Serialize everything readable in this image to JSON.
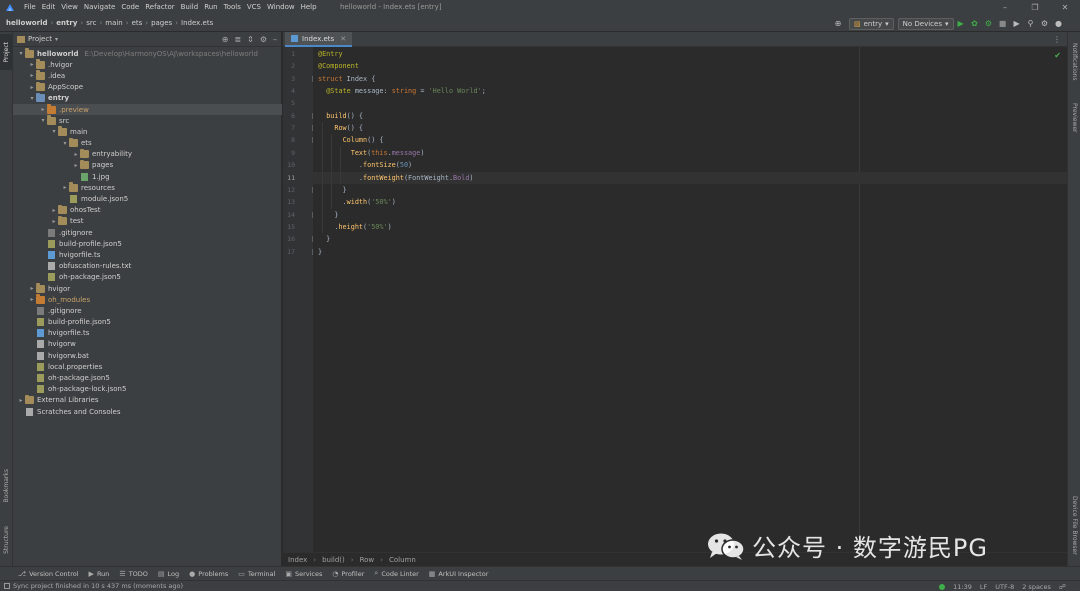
{
  "titlebar": {
    "menu": [
      "File",
      "Edit",
      "View",
      "Navigate",
      "Code",
      "Refactor",
      "Build",
      "Run",
      "Tools",
      "VCS",
      "Window",
      "Help"
    ],
    "window_title": "helloworld - Index.ets [entry]"
  },
  "breadcrumb": [
    "helloworld",
    "entry",
    "src",
    "main",
    "ets",
    "pages",
    "Index.ets"
  ],
  "toolbar": {
    "module": "entry",
    "device": "No Devices"
  },
  "left_strip": {
    "project": "Project",
    "bookmarks": "Bookmarks",
    "structure": "Structure"
  },
  "right_strip": {
    "notifications": "Notifications",
    "previewer": "Previewer",
    "device_file_browser": "Device File Browser"
  },
  "project_panel": {
    "title": "Project",
    "tree": [
      {
        "label": "helloworld",
        "path": "E:\\Develop\\HarmonyOS\\AJ\\workspaces\\helloworld",
        "level": 0,
        "type": "folder",
        "expanded": true,
        "bold": true
      },
      {
        "label": ".hvigor",
        "level": 1,
        "type": "folder",
        "expanded": false
      },
      {
        "label": ".idea",
        "level": 1,
        "type": "folder",
        "expanded": false
      },
      {
        "label": "AppScope",
        "level": 1,
        "type": "folder",
        "expanded": false
      },
      {
        "label": "entry",
        "level": 1,
        "type": "folder-blue",
        "expanded": true,
        "bold": true
      },
      {
        "label": ".preview",
        "level": 2,
        "type": "folder-orange",
        "expanded": false,
        "selected": true,
        "orange": true
      },
      {
        "label": "src",
        "level": 2,
        "type": "folder",
        "expanded": true
      },
      {
        "label": "main",
        "level": 3,
        "type": "folder",
        "expanded": true
      },
      {
        "label": "ets",
        "level": 4,
        "type": "folder",
        "expanded": true
      },
      {
        "label": "entryability",
        "level": 5,
        "type": "folder",
        "expanded": false
      },
      {
        "label": "pages",
        "level": 5,
        "type": "folder",
        "expanded": false
      },
      {
        "label": "1.jpg",
        "level": 5,
        "type": "img"
      },
      {
        "label": "resources",
        "level": 4,
        "type": "folder",
        "expanded": false
      },
      {
        "label": "module.json5",
        "level": 4,
        "type": "json"
      },
      {
        "label": "ohosTest",
        "level": 3,
        "type": "folder",
        "expanded": false
      },
      {
        "label": "test",
        "level": 3,
        "type": "folder",
        "expanded": false
      },
      {
        "label": ".gitignore",
        "level": 2,
        "type": "git"
      },
      {
        "label": "build-profile.json5",
        "level": 2,
        "type": "json"
      },
      {
        "label": "hvigorfile.ts",
        "level": 2,
        "type": "ts"
      },
      {
        "label": "obfuscation-rules.txt",
        "level": 2,
        "type": "txt"
      },
      {
        "label": "oh-package.json5",
        "level": 2,
        "type": "json"
      },
      {
        "label": "hvigor",
        "level": 1,
        "type": "folder",
        "expanded": false
      },
      {
        "label": "oh_modules",
        "level": 1,
        "type": "folder-orange",
        "expanded": false,
        "orange": true
      },
      {
        "label": ".gitignore",
        "level": 1,
        "type": "git"
      },
      {
        "label": "build-profile.json5",
        "level": 1,
        "type": "json"
      },
      {
        "label": "hvigorfile.ts",
        "level": 1,
        "type": "ts"
      },
      {
        "label": "hvigorw",
        "level": 1,
        "type": "txt"
      },
      {
        "label": "hvigorw.bat",
        "level": 1,
        "type": "txt"
      },
      {
        "label": "local.properties",
        "level": 1,
        "type": "json"
      },
      {
        "label": "oh-package.json5",
        "level": 1,
        "type": "json"
      },
      {
        "label": "oh-package-lock.json5",
        "level": 1,
        "type": "json"
      },
      {
        "label": "External Libraries",
        "level": 0,
        "type": "lib",
        "expanded": false
      },
      {
        "label": "Scratches and Consoles",
        "level": 0,
        "type": "scratch",
        "noarrow": true
      }
    ]
  },
  "editor": {
    "tab": "Index.ets",
    "current_line": 11,
    "lines": [
      [
        [
          "ann",
          "@Entry"
        ]
      ],
      [
        [
          "ann",
          "@Component"
        ]
      ],
      [
        [
          "kw",
          "struct "
        ],
        [
          "cls",
          "Index "
        ],
        [
          "plain",
          "{"
        ]
      ],
      [
        [
          "plain",
          "  "
        ],
        [
          "ann",
          "@State "
        ],
        [
          "plain",
          "message: "
        ],
        [
          "kw",
          "string "
        ],
        [
          "plain",
          "= "
        ],
        [
          "str",
          "'Hello World'"
        ],
        [
          "plain",
          ";"
        ]
      ],
      [],
      [
        [
          "plain",
          "  "
        ],
        [
          "fn",
          "build"
        ],
        [
          "plain",
          "() {"
        ]
      ],
      [
        [
          "plain",
          "    "
        ],
        [
          "fn",
          "Row"
        ],
        [
          "plain",
          "() {"
        ]
      ],
      [
        [
          "plain",
          "      "
        ],
        [
          "fn",
          "Column"
        ],
        [
          "plain",
          "() {"
        ]
      ],
      [
        [
          "plain",
          "        "
        ],
        [
          "fn",
          "Text"
        ],
        [
          "plain",
          "("
        ],
        [
          "kw",
          "this"
        ],
        [
          "plain",
          "."
        ],
        [
          "prop",
          "message"
        ],
        [
          "plain",
          ")"
        ]
      ],
      [
        [
          "plain",
          "          ."
        ],
        [
          "fn",
          "fontSize"
        ],
        [
          "plain",
          "("
        ],
        [
          "num",
          "50"
        ],
        [
          "plain",
          ")"
        ]
      ],
      [
        [
          "plain",
          "          ."
        ],
        [
          "fn",
          "fontWeight"
        ],
        [
          "plain",
          "(FontWeight."
        ],
        [
          "prop",
          "Bold"
        ],
        [
          "plain",
          ")"
        ]
      ],
      [
        [
          "plain",
          "      }"
        ]
      ],
      [
        [
          "plain",
          "      ."
        ],
        [
          "fn",
          "width"
        ],
        [
          "plain",
          "("
        ],
        [
          "str",
          "'50%'"
        ],
        [
          "plain",
          ")"
        ]
      ],
      [
        [
          "plain",
          "    }"
        ]
      ],
      [
        [
          "plain",
          "    ."
        ],
        [
          "fn",
          "height"
        ],
        [
          "plain",
          "("
        ],
        [
          "str",
          "'50%'"
        ],
        [
          "plain",
          ")"
        ]
      ],
      [
        [
          "plain",
          "  }"
        ]
      ],
      [
        [
          "plain",
          "}"
        ]
      ]
    ]
  },
  "editor_breadcrumb": [
    "Index",
    "build()",
    "Row",
    "Column"
  ],
  "tool_windows": [
    {
      "label": "Version Control",
      "icon": "version-control-icon"
    },
    {
      "label": "Run",
      "icon": "run-icon"
    },
    {
      "label": "TODO",
      "icon": "todo-icon"
    },
    {
      "label": "Log",
      "icon": "log-icon"
    },
    {
      "label": "Problems",
      "icon": "problems-icon"
    },
    {
      "label": "Terminal",
      "icon": "terminal-icon"
    },
    {
      "label": "Services",
      "icon": "services-icon"
    },
    {
      "label": "Profiler",
      "icon": "profiler-icon"
    },
    {
      "label": "Code Linter",
      "icon": "code-linter-icon"
    },
    {
      "label": "ArkUI Inspector",
      "icon": "arkui-inspector-icon"
    }
  ],
  "status_bar": {
    "message": "Sync project finished in 10 s 437 ms (moments ago)",
    "position": "11:39",
    "line_ending": "LF",
    "encoding": "UTF-8",
    "indent": "2 spaces"
  },
  "watermark": {
    "text": "公众号 · 数字游民PG"
  },
  "colors": {
    "background": "#2b2b2b",
    "panel": "#3c3f41",
    "accent": "#4a88c7",
    "run_green": "#3fae49"
  }
}
